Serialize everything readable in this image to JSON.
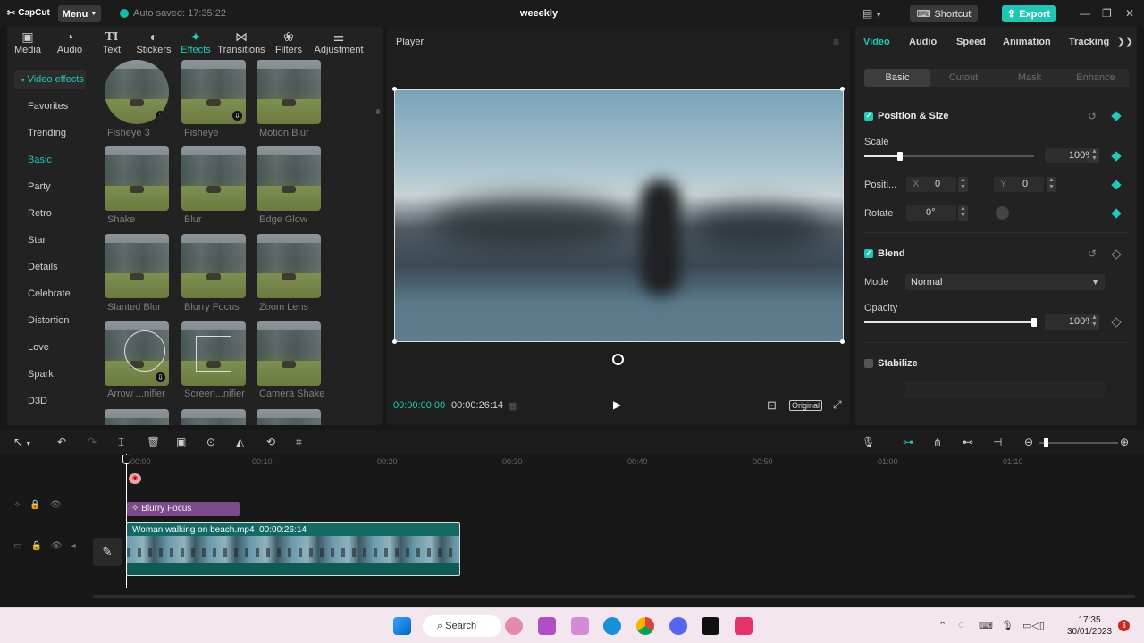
{
  "app": {
    "logo_text": "CapCut",
    "menu_label": "Menu",
    "autosave": "Auto saved: 17:35:22",
    "project_title": "weeekly",
    "shortcut_label": "Shortcut",
    "export_label": "Export",
    "accent": "#20c5b4"
  },
  "media_tabs": [
    {
      "label": "Media",
      "glyph": "▣"
    },
    {
      "label": "Audio",
      "glyph": "◔"
    },
    {
      "label": "Text",
      "glyph": "TI"
    },
    {
      "label": "Stickers",
      "glyph": "◐"
    },
    {
      "label": "Effects",
      "glyph": "✦"
    },
    {
      "label": "Transitions",
      "glyph": "⋈"
    },
    {
      "label": "Filters",
      "glyph": "❀"
    },
    {
      "label": "Adjustment",
      "glyph": "⚌"
    }
  ],
  "effects_panel": {
    "header": "Video effects",
    "categories": [
      "Favorites",
      "Trending",
      "Basic",
      "Party",
      "Retro",
      "Star",
      "Details",
      "Celebrate",
      "Distortion",
      "Love",
      "Spark",
      "D3D"
    ],
    "items": [
      "Fisheye 3",
      "Fisheye",
      "Motion Blur",
      "Shake",
      "Blur",
      "Edge Glow",
      "Slanted Blur",
      "Blurry Focus",
      "Zoom Lens",
      "Arrow ...nifier",
      "Screen...nifier",
      "Camera Shake"
    ]
  },
  "player": {
    "title": "Player",
    "current_time": "00:00:00:00",
    "duration": "00:00:26:14",
    "ratio_label": "Original"
  },
  "inspector": {
    "tabs": [
      "Video",
      "Audio",
      "Speed",
      "Animation",
      "Tracking"
    ],
    "subtabs": [
      "Basic",
      "Cutout",
      "Mask",
      "Enhance"
    ],
    "position_size": {
      "title": "Position & Size",
      "scale_label": "Scale",
      "scale_value": "100%",
      "scale_level": 0.21,
      "position_label": "Positi...",
      "x_label": "X",
      "x_value": "0",
      "y_label": "Y",
      "y_value": "0",
      "rotate_label": "Rotate",
      "rotate_value": "0°"
    },
    "blend": {
      "title": "Blend",
      "mode_label": "Mode",
      "mode_value": "Normal",
      "opacity_label": "Opacity",
      "opacity_value": "100%",
      "opacity_level": 1.0
    },
    "stabilize": {
      "title": "Stabilize"
    }
  },
  "timeline": {
    "ruler": [
      "00:00",
      "00:10",
      "00:20",
      "00:30",
      "00:40",
      "00:50",
      "01:00",
      "01:10"
    ],
    "effect_clip": "Blurry Focus",
    "video_clip": {
      "name": "Woman walking on beach.mp4",
      "duration": "00:00:26:14"
    }
  },
  "taskbar": {
    "search_label": "Search",
    "time": "17:35",
    "date": "30/01/2023",
    "notifications": "3"
  }
}
